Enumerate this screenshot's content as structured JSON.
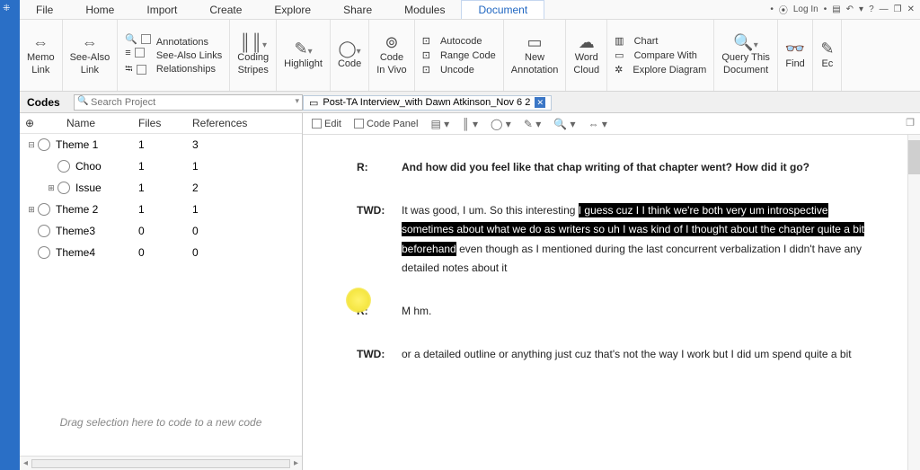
{
  "menu": {
    "file": "File",
    "home": "Home",
    "import": "Import",
    "create": "Create",
    "explore": "Explore",
    "share": "Share",
    "modules": "Modules",
    "document": "Document"
  },
  "title_right": {
    "login": "Log In"
  },
  "ribbon": {
    "memo": "Memo\nLink",
    "seealso": "See-Also\nLink",
    "annotations": "Annotations",
    "seealso_links": "See-Also Links",
    "relationships": "Relationships",
    "coding_stripes": "Coding\nStripes",
    "highlight": "Highlight",
    "code": "Code",
    "codeinvivo": "Code\nIn Vivo",
    "autocode": "Autocode",
    "rangecode": "Range Code",
    "uncode": "Uncode",
    "new_annotation": "New\nAnnotation",
    "word_cloud": "Word\nCloud",
    "chart": "Chart",
    "compare": "Compare With",
    "explore_diagram": "Explore Diagram",
    "query": "Query This\nDocument",
    "find": "Find",
    "ed": "Ec"
  },
  "codes": {
    "label": "Codes",
    "search_placeholder": "Search Project",
    "columns": {
      "name": "Name",
      "files": "Files",
      "refs": "References"
    },
    "rows": [
      {
        "exp": "⊟",
        "name": "Theme 1",
        "files": "1",
        "refs": "3"
      },
      {
        "child": true,
        "name": "Choo",
        "files": "1",
        "refs": "1"
      },
      {
        "exp": "⊞",
        "child": true,
        "name": "Issue",
        "files": "1",
        "refs": "2"
      },
      {
        "exp": "⊞",
        "name": "Theme 2",
        "files": "1",
        "refs": "1"
      },
      {
        "name": "Theme3",
        "files": "0",
        "refs": "0"
      },
      {
        "name": "Theme4",
        "files": "0",
        "refs": "0"
      }
    ],
    "hint": "Drag selection here to code to a new code"
  },
  "doc": {
    "tab": "Post-TA Interview_with Dawn Atkinson_Nov 6 2",
    "toolbar": {
      "edit": "Edit",
      "codepanel": "Code Panel"
    },
    "rows": [
      {
        "sp": "R:",
        "bold": true,
        "text": "And how did you feel like that chap writing of that chapter went?  How did it go?"
      },
      {
        "sp": "TWD:",
        "pre": "It was good, I um.  So this interesting ",
        "hl": "I guess cuz I I think we're both very um introspective sometimes about what we do as writers so uh I was kind of I thought about the chapter quite a bit beforehand",
        "post": " even though as I mentioned during the last concurrent verbalization I didn't have any detailed notes about it"
      },
      {
        "sp": "R:",
        "text": "M hm."
      },
      {
        "sp": "TWD:",
        "text": "or a detailed outline or anything just cuz that's not the way I work but I did um spend quite a bit"
      }
    ]
  }
}
